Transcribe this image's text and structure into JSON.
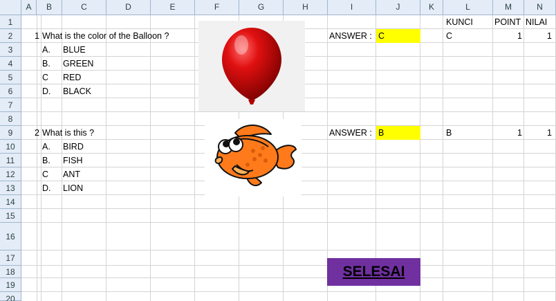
{
  "columns": [
    "A",
    "B",
    "C",
    "D",
    "E",
    "F",
    "G",
    "H",
    "I",
    "J",
    "K",
    "L",
    "M",
    "N"
  ],
  "rows": [
    "1",
    "2",
    "3",
    "4",
    "5",
    "6",
    "7",
    "8",
    "9",
    "10",
    "11",
    "12",
    "13",
    "14",
    "15",
    "16",
    "17",
    "18",
    "19",
    "20"
  ],
  "header_labels": {
    "kunci": "KUNCI",
    "point": "POINT",
    "nilai": "NILAI"
  },
  "questions": [
    {
      "number": "1",
      "text": "What is the color of the Balloon ?",
      "options": [
        {
          "letter": "A.",
          "text": "BLUE"
        },
        {
          "letter": "B.",
          "text": "GREEN"
        },
        {
          "letter": "C",
          "text": "RED"
        },
        {
          "letter": "D.",
          "text": "BLACK"
        }
      ],
      "answer_label": "ANSWER :",
      "answer_value": "C",
      "kunci": "C",
      "point": "1",
      "nilai": "1",
      "image_icon": "red-balloon"
    },
    {
      "number": "2",
      "text": "What is this ?",
      "options": [
        {
          "letter": "A.",
          "text": "BIRD"
        },
        {
          "letter": "B.",
          "text": "FISH"
        },
        {
          "letter": "C",
          "text": "ANT"
        },
        {
          "letter": "D.",
          "text": "LION"
        }
      ],
      "answer_label": "ANSWER :",
      "answer_value": "B",
      "kunci": "B",
      "point": "1",
      "nilai": "1",
      "image_icon": "cartoon-goldfish"
    }
  ],
  "finish_button": {
    "label": "SELESAI",
    "color": "#7030a0"
  },
  "colors": {
    "answer_fill": "#ffff00",
    "balloon": "#e01010",
    "fish": "#ff7a1a",
    "header_bg": "#e4ecf7"
  }
}
